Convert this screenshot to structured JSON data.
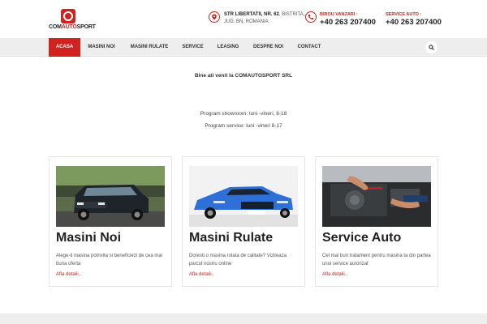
{
  "brand": {
    "logo_prefix": "COM",
    "logo_highlight": "AUTO",
    "logo_suffix": "SPORT",
    "accent_color": "#d0221f"
  },
  "header": {
    "address_street": "STR LIBERTATII, NR. 62",
    "address_city": ", BISTRITA,",
    "address_region": "JUD. BN, ROMANIA",
    "sales_label": "BIROU VANZARI :",
    "sales_phone": "+40 263 207400",
    "service_label": "SERVICE AUTO :",
    "service_phone": "+40 263 207400"
  },
  "nav": {
    "items": [
      {
        "label": "ACASA"
      },
      {
        "label": "MASINI NOI"
      },
      {
        "label": "MASINI RULATE"
      },
      {
        "label": "SERVICE"
      },
      {
        "label": "LEASING"
      },
      {
        "label": "DESPRE NOI"
      },
      {
        "label": "CONTACT"
      }
    ]
  },
  "intro": {
    "welcome": "Bine ati venit la COMAUTOSPORT  SRL",
    "showroom_hours": "Program showroom:  luni -vineri, 8-18",
    "service_hours": "Program service: luni -vineri  8-17"
  },
  "cards": [
    {
      "title": "Masini Noi",
      "description": "Alege-ti masina potrivita si beneficiezi de cea mai buna oferta",
      "link": "Afla detalii.."
    },
    {
      "title": "Masini Rulate",
      "description": "Doresti o masina rulata de calitate? Viziteaza parcul nostru online",
      "link": "Afla detalii.."
    },
    {
      "title": "Service Auto",
      "description": "Cel mai bun tratament pentru masina ta din partea unui service autorizat",
      "link": "Afla detalii.."
    }
  ]
}
